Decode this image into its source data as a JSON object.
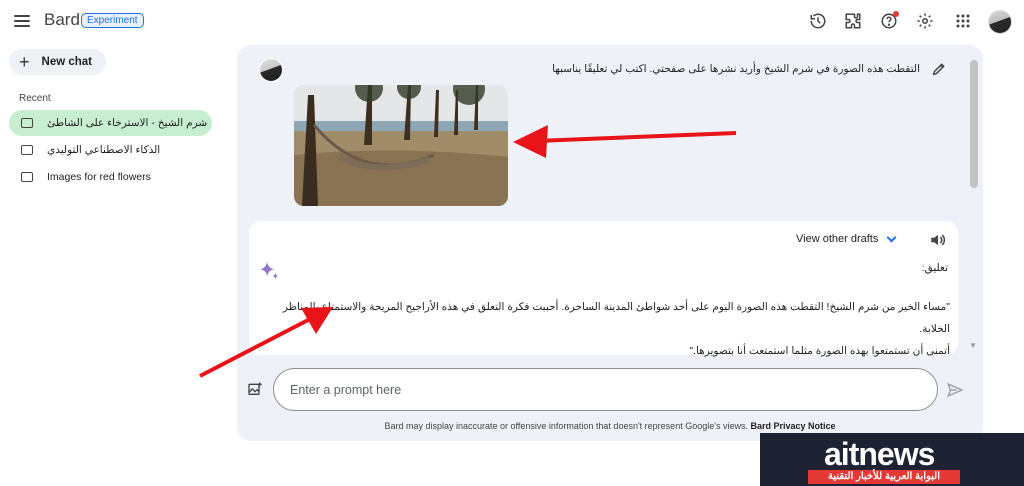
{
  "header": {
    "brand": "Bard",
    "badge": "Experiment",
    "icons": [
      "menu-icon",
      "history-icon",
      "extensions-icon",
      "help-icon",
      "settings-icon",
      "apps-grid-icon",
      "avatar"
    ]
  },
  "sidebar": {
    "new_chat_label": "New chat",
    "recent_label": "Recent",
    "items": [
      {
        "label": "شرم الشيخ - الاسترخاء على الشاطئ",
        "active": true
      },
      {
        "label": "الذكاء الاصطناعي التوليدي",
        "active": false
      },
      {
        "label": "Images for red flowers",
        "active": false
      }
    ]
  },
  "conversation": {
    "user_message": "التقطت هذه الصورة في شرم الشيخ وأريد نشرها على صفحتي. اكتب لي تعليقًا يناسبها",
    "view_drafts_label": "View other drafts",
    "response_label": "تعليق:",
    "response_lines": [
      "\"مساء الخير من شرم الشيخ! التقطت هذه الصورة اليوم على أحد شواطئ المدينة الساحرة. أحببت فكرة التعلق في هذه الأراجيح المريحة والاستمتاع بالمناظر الخلابة.",
      "أتمنى أن تستمتعوا بهذه الصورة مثلما استمتعت أنا بتصويرها.\""
    ]
  },
  "prompt": {
    "placeholder": "Enter a prompt here"
  },
  "footer": {
    "disclaimer": "Bard may display inaccurate or offensive information that doesn't represent Google's views.",
    "privacy_link": "Bard Privacy Notice"
  },
  "watermark": {
    "logo": "aitnews",
    "tagline": "البوابة العربية للأخبار التقنية"
  },
  "colors": {
    "accent": "#1a73e8",
    "active_item": "#c7eed0",
    "panel": "#eef2f8",
    "arrow": "#e8141a",
    "notification_dot": "#e53935"
  }
}
